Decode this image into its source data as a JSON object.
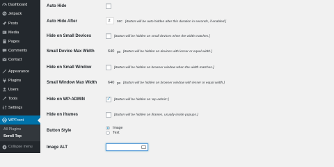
{
  "sidebar": {
    "items": [
      {
        "label": "Dashboard",
        "icon": "dashboard-icon"
      },
      {
        "label": "Jetpack",
        "icon": "jetpack-icon"
      },
      {
        "label": "Posts",
        "icon": "pin-icon"
      },
      {
        "label": "Media",
        "icon": "media-icon"
      },
      {
        "label": "Pages",
        "icon": "page-icon"
      },
      {
        "label": "Comments",
        "icon": "comment-icon"
      },
      {
        "label": "Contact",
        "icon": "mail-icon"
      },
      {
        "label": "Appearance",
        "icon": "brush-icon"
      },
      {
        "label": "Plugins",
        "icon": "plugin-icon"
      },
      {
        "label": "Users",
        "icon": "user-icon"
      },
      {
        "label": "Tools",
        "icon": "wrench-icon"
      },
      {
        "label": "Settings",
        "icon": "settings-icon"
      }
    ],
    "active": {
      "label": "WPFront",
      "icon": "wpfront-icon"
    },
    "submenu": [
      "All Plugins",
      "Scroll Top"
    ],
    "collapse_label": "Collapse menu"
  },
  "form": {
    "auto_hide": {
      "label": "Auto Hide",
      "checked": false
    },
    "auto_hide_after": {
      "label": "Auto Hide After",
      "value": "2",
      "unit": "sec",
      "description": "[Button will be auto hidden after this duration in seconds, if enabled.]"
    },
    "hide_small_devices": {
      "label": "Hide on Small Devices",
      "checked": false,
      "description": "[Button will be hidden on small devices when the width matches.]"
    },
    "small_device_max_width": {
      "label": "Small Device Max Width",
      "value": "640",
      "unit": "px",
      "description": "[Button will be hidden on devices with lesser or equal width.]"
    },
    "hide_small_window": {
      "label": "Hide on Small Window",
      "checked": false,
      "description": "[Button will be hidden on browser window when the width matches.]"
    },
    "small_window_max_width": {
      "label": "Small Window Max Width",
      "value": "640",
      "unit": "px",
      "description": "[Button will be hidden on browser window with lesser or equal width.]"
    },
    "hide_wp_admin": {
      "label": "Hide on WP-ADMIN",
      "checked": true,
      "description": "[Button will be hidden on 'wp-admin'.]"
    },
    "hide_iframes": {
      "label": "Hide on iframes",
      "checked": false,
      "description": "[Button will be hidden on iframes, usually inside popups.]"
    },
    "button_style": {
      "label": "Button Style",
      "options": [
        "Image",
        "Text"
      ],
      "selected": "Image"
    },
    "image_alt": {
      "label": "Image ALT",
      "value": ""
    }
  },
  "colors": {
    "sidebar_bg": "#23282d",
    "active_bg": "#0073aa",
    "submenu_bg": "#32373c",
    "content_bg": "#f1f1f1",
    "check_color": "#1e8cbe"
  }
}
